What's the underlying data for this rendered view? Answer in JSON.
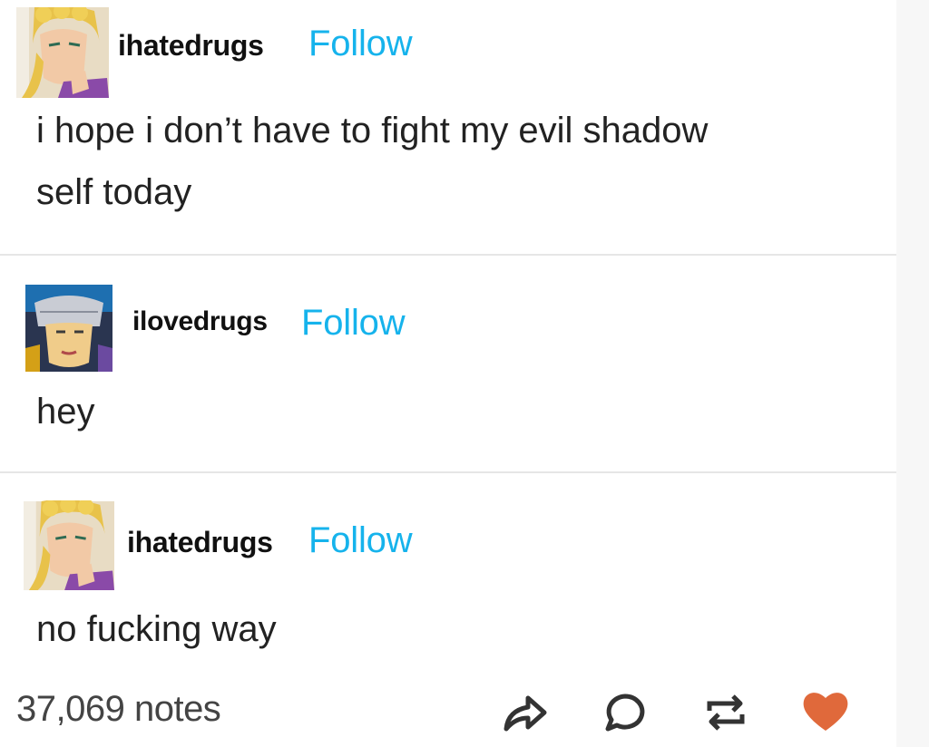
{
  "posts": [
    {
      "username": "ihatedrugs",
      "follow_label": "Follow",
      "text_lines": [
        "i hope i don’t have to fight my evil shadow",
        "self today"
      ]
    },
    {
      "username": "ilovedrugs",
      "follow_label": "Follow",
      "text_lines": [
        "hey"
      ]
    },
    {
      "username": "ihatedrugs",
      "follow_label": "Follow",
      "text_lines": [
        "no fucking way"
      ]
    }
  ],
  "footer": {
    "notes": "37,069 notes",
    "icons": [
      "share-icon",
      "reply-icon",
      "reblog-icon",
      "like-icon"
    ]
  },
  "colors": {
    "follow": "#16b3ec",
    "like": "#e0693b",
    "icon": "#333333",
    "divider": "#e6e6e6"
  }
}
